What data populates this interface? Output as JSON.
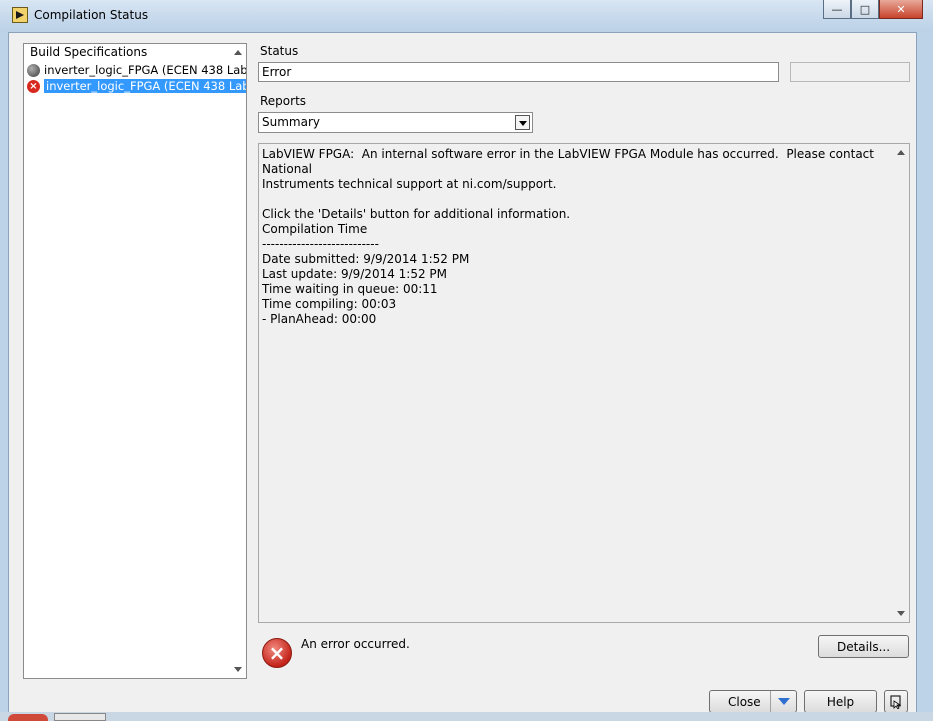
{
  "window": {
    "title": "Compilation Status"
  },
  "build_list": {
    "header": "Build Specifications",
    "items": [
      {
        "label": "inverter_logic_FPGA (ECEN 438 Lab",
        "status": "grey",
        "selected": false
      },
      {
        "label": "inverter_logic_FPGA (ECEN 438 Lab",
        "status": "error",
        "selected": true
      }
    ]
  },
  "status": {
    "label": "Status",
    "value": "Error",
    "extra_value": ""
  },
  "reports": {
    "label": "Reports",
    "selected": "Summary"
  },
  "report_text": {
    "line1": "LabVIEW FPGA:  An internal software error in the LabVIEW FPGA Module has occurred.  Please contact National",
    "line2": "Instruments technical support at ni.com/support.",
    "line3": "Click the 'Details' button for additional information.",
    "line4": "Compilation Time",
    "line5": "---------------------------",
    "line6": "Date submitted: 9/9/2014 1:52 PM",
    "line7": "Last update: 9/9/2014 1:52 PM",
    "line8": "Time waiting in queue: 00:11",
    "line9": "Time compiling: 00:03",
    "line10": "- PlanAhead: 00:00"
  },
  "error_message": "An error occurred.",
  "buttons": {
    "details": "Details...",
    "close": "Close",
    "help": "Help"
  },
  "icons": {
    "error": "×",
    "app": "labview-icon"
  }
}
